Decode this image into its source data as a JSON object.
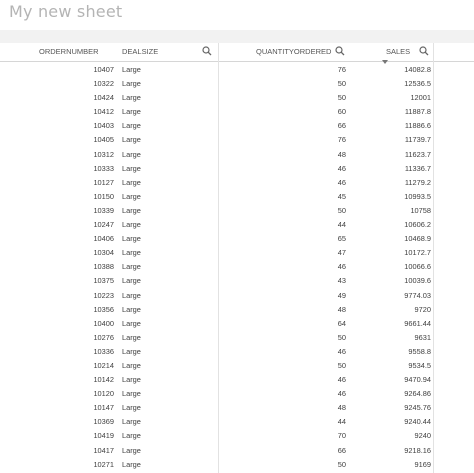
{
  "sheet": {
    "title": "My new sheet"
  },
  "columns": {
    "ordernumber": "ORDERNUMBER",
    "dealsize": "DEALSIZE",
    "quantityordered": "QUANTITYORDERED",
    "sales": "SALES"
  },
  "sorted_column": "sales",
  "sort_direction": "descending",
  "rows": [
    {
      "order": "10407",
      "deal": "Large",
      "qty": "76",
      "sales": "14082.8"
    },
    {
      "order": "10322",
      "deal": "Large",
      "qty": "50",
      "sales": "12536.5"
    },
    {
      "order": "10424",
      "deal": "Large",
      "qty": "50",
      "sales": "12001"
    },
    {
      "order": "10412",
      "deal": "Large",
      "qty": "60",
      "sales": "11887.8"
    },
    {
      "order": "10403",
      "deal": "Large",
      "qty": "66",
      "sales": "11886.6"
    },
    {
      "order": "10405",
      "deal": "Large",
      "qty": "76",
      "sales": "11739.7"
    },
    {
      "order": "10312",
      "deal": "Large",
      "qty": "48",
      "sales": "11623.7"
    },
    {
      "order": "10333",
      "deal": "Large",
      "qty": "46",
      "sales": "11336.7"
    },
    {
      "order": "10127",
      "deal": "Large",
      "qty": "46",
      "sales": "11279.2"
    },
    {
      "order": "10150",
      "deal": "Large",
      "qty": "45",
      "sales": "10993.5"
    },
    {
      "order": "10339",
      "deal": "Large",
      "qty": "50",
      "sales": "10758"
    },
    {
      "order": "10247",
      "deal": "Large",
      "qty": "44",
      "sales": "10606.2"
    },
    {
      "order": "10406",
      "deal": "Large",
      "qty": "65",
      "sales": "10468.9"
    },
    {
      "order": "10304",
      "deal": "Large",
      "qty": "47",
      "sales": "10172.7"
    },
    {
      "order": "10388",
      "deal": "Large",
      "qty": "46",
      "sales": "10066.6"
    },
    {
      "order": "10375",
      "deal": "Large",
      "qty": "43",
      "sales": "10039.6"
    },
    {
      "order": "10223",
      "deal": "Large",
      "qty": "49",
      "sales": "9774.03"
    },
    {
      "order": "10356",
      "deal": "Large",
      "qty": "48",
      "sales": "9720"
    },
    {
      "order": "10400",
      "deal": "Large",
      "qty": "64",
      "sales": "9661.44"
    },
    {
      "order": "10276",
      "deal": "Large",
      "qty": "50",
      "sales": "9631"
    },
    {
      "order": "10336",
      "deal": "Large",
      "qty": "46",
      "sales": "9558.8"
    },
    {
      "order": "10214",
      "deal": "Large",
      "qty": "50",
      "sales": "9534.5"
    },
    {
      "order": "10142",
      "deal": "Large",
      "qty": "46",
      "sales": "9470.94"
    },
    {
      "order": "10120",
      "deal": "Large",
      "qty": "46",
      "sales": "9264.86"
    },
    {
      "order": "10147",
      "deal": "Large",
      "qty": "48",
      "sales": "9245.76"
    },
    {
      "order": "10369",
      "deal": "Large",
      "qty": "44",
      "sales": "9240.44"
    },
    {
      "order": "10419",
      "deal": "Large",
      "qty": "70",
      "sales": "9240"
    },
    {
      "order": "10417",
      "deal": "Large",
      "qty": "66",
      "sales": "9218.16"
    },
    {
      "order": "10271",
      "deal": "Large",
      "qty": "50",
      "sales": "9169"
    }
  ],
  "icons": {
    "column_search": "search-icon",
    "sort_indicator": "sort-descending-arrow"
  }
}
